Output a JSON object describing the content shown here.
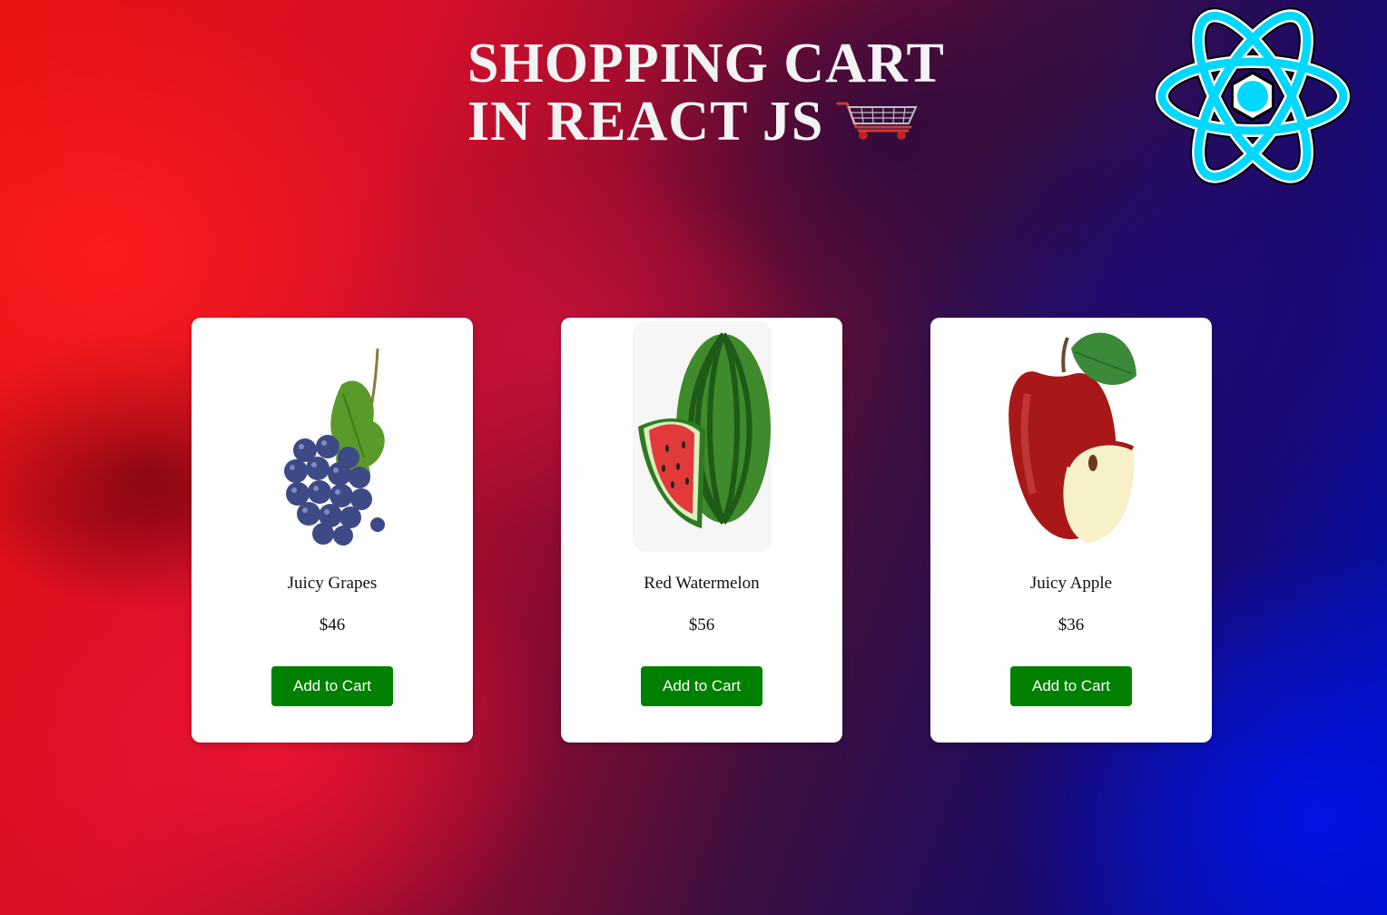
{
  "header": {
    "title_line1": "SHOPPING CART",
    "title_line2": "IN REACT JS",
    "cart_icon": "shopping-cart-icon",
    "logo_icon": "react-logo-icon"
  },
  "colors": {
    "button_bg": "#008000",
    "button_text": "#ffffff",
    "card_bg": "#ffffff",
    "react_cyan": "#00d8ff",
    "title": "#f3f3f3"
  },
  "products": [
    {
      "name": "Juicy Grapes",
      "price": "$46",
      "button_label": "Add to Cart",
      "image": "grapes-image"
    },
    {
      "name": "Red Watermelon",
      "price": "$56",
      "button_label": "Add to Cart",
      "image": "watermelon-image"
    },
    {
      "name": "Juicy Apple",
      "price": "$36",
      "button_label": "Add to Cart",
      "image": "apple-image"
    }
  ]
}
